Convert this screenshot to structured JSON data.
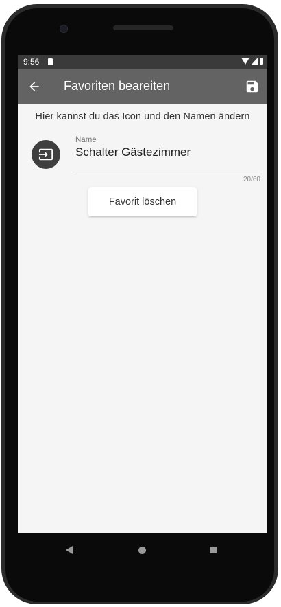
{
  "status_bar": {
    "time": "9:56"
  },
  "app_bar": {
    "title": "Favoriten beareiten",
    "back_icon": "arrow-back-icon",
    "save_icon": "save-icon",
    "background": "#636363"
  },
  "main": {
    "hint": "Hier kannst du das Icon und den Namen ändern",
    "favorite_icon": "input-icon",
    "name_field": {
      "label": "Name",
      "value": "Schalter Gästezimmer",
      "counter": "20/60"
    },
    "delete_button_label": "Favorit löschen"
  },
  "nav_bar": {
    "back_icon": "nav-back-icon",
    "home_icon": "nav-home-icon",
    "recents_icon": "nav-recents-icon"
  }
}
